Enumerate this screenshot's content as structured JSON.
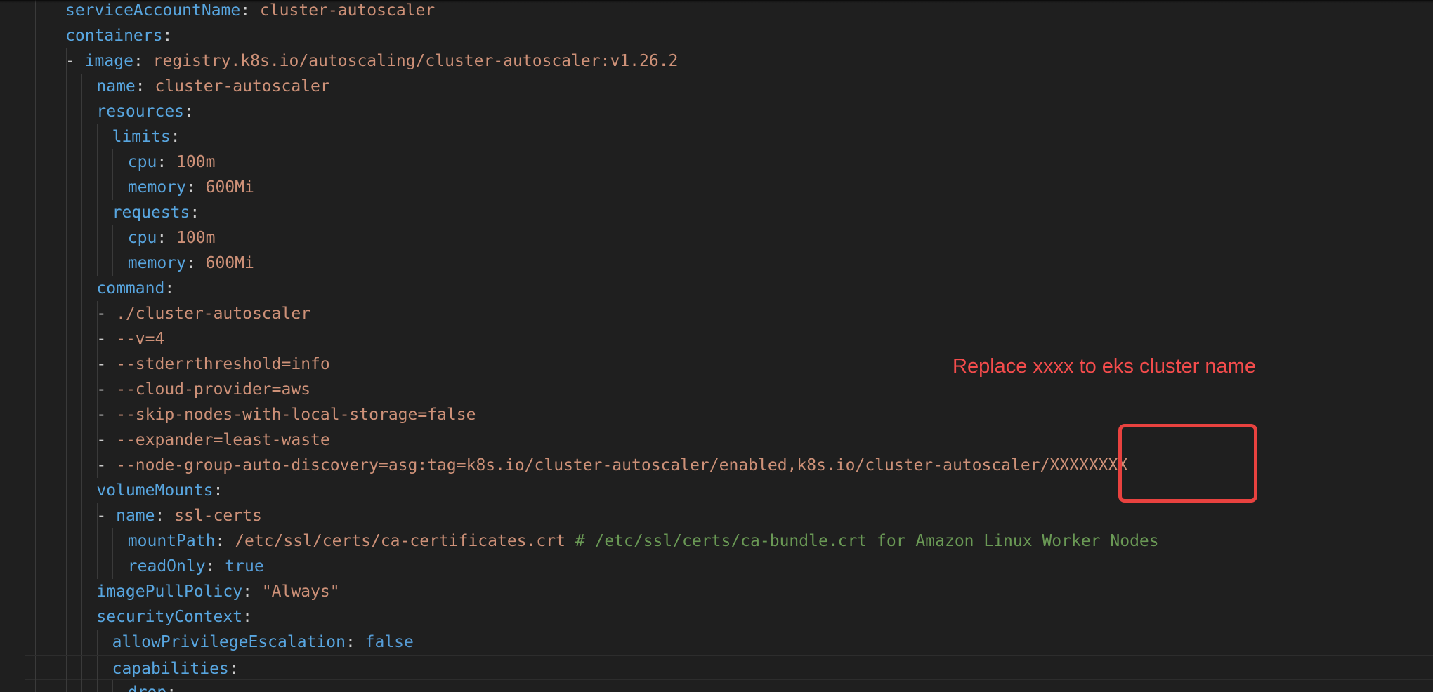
{
  "annotation": {
    "note": "Replace xxxx to eks cluster name"
  },
  "lines": [
    {
      "dash": "",
      "key": "serviceAccountName",
      "sep": ": ",
      "value": "cluster-autoscaler",
      "vtype": "s"
    },
    {
      "dash": "",
      "key": "containers",
      "sep": ":",
      "value": "",
      "vtype": "s"
    },
    {
      "dash": "- ",
      "key": "image",
      "sep": ": ",
      "value": "registry.k8s.io/autoscaling/cluster-autoscaler:v1.26.2",
      "vtype": "s"
    },
    {
      "dash": "",
      "key": "name",
      "sep": ": ",
      "value": "cluster-autoscaler",
      "vtype": "s"
    },
    {
      "dash": "",
      "key": "resources",
      "sep": ":",
      "value": "",
      "vtype": "s"
    },
    {
      "dash": "",
      "key": "limits",
      "sep": ":",
      "value": "",
      "vtype": "s"
    },
    {
      "dash": "",
      "key": "cpu",
      "sep": ": ",
      "value": "100m",
      "vtype": "s"
    },
    {
      "dash": "",
      "key": "memory",
      "sep": ": ",
      "value": "600Mi",
      "vtype": "s"
    },
    {
      "dash": "",
      "key": "requests",
      "sep": ":",
      "value": "",
      "vtype": "s"
    },
    {
      "dash": "",
      "key": "cpu",
      "sep": ": ",
      "value": "100m",
      "vtype": "s"
    },
    {
      "dash": "",
      "key": "memory",
      "sep": ": ",
      "value": "600Mi",
      "vtype": "s"
    },
    {
      "dash": "",
      "key": "command",
      "sep": ":",
      "value": "",
      "vtype": "s"
    },
    {
      "dash": "- ",
      "key": "",
      "sep": "",
      "value": "./cluster-autoscaler",
      "vtype": "s"
    },
    {
      "dash": "- ",
      "key": "",
      "sep": "",
      "value": "--v=4",
      "vtype": "s"
    },
    {
      "dash": "- ",
      "key": "",
      "sep": "",
      "value": "--stderrthreshold=info",
      "vtype": "s"
    },
    {
      "dash": "- ",
      "key": "",
      "sep": "",
      "value": "--cloud-provider=aws",
      "vtype": "s"
    },
    {
      "dash": "- ",
      "key": "",
      "sep": "",
      "value": "--skip-nodes-with-local-storage=false",
      "vtype": "s"
    },
    {
      "dash": "- ",
      "key": "",
      "sep": "",
      "value": "--expander=least-waste",
      "vtype": "s"
    },
    {
      "dash": "- ",
      "key": "",
      "sep": "",
      "value": "--node-group-auto-discovery=asg:tag=k8s.io/cluster-autoscaler/enabled,k8s.io/cluster-autoscaler/XXXXXXXX",
      "vtype": "s"
    },
    {
      "dash": "",
      "key": "volumeMounts",
      "sep": ":",
      "value": "",
      "vtype": "s"
    },
    {
      "dash": "- ",
      "key": "name",
      "sep": ": ",
      "value": "ssl-certs",
      "vtype": "s"
    },
    {
      "dash": "",
      "key": "mountPath",
      "sep": ": ",
      "value": "/etc/ssl/certs/ca-certificates.crt",
      "vtype": "s",
      "comment": " # /etc/ssl/certs/ca-bundle.crt for Amazon Linux Worker Nodes"
    },
    {
      "dash": "",
      "key": "readOnly",
      "sep": ": ",
      "value": "true",
      "vtype": "b"
    },
    {
      "dash": "",
      "key": "imagePullPolicy",
      "sep": ": ",
      "value": "\"Always\"",
      "vtype": "s"
    },
    {
      "dash": "",
      "key": "securityContext",
      "sep": ":",
      "value": "",
      "vtype": "s"
    },
    {
      "dash": "",
      "key": "allowPrivilegeEscalation",
      "sep": ": ",
      "value": "false",
      "vtype": "b"
    },
    {
      "dash": "",
      "key": "capabilities",
      "sep": ":",
      "value": "",
      "vtype": "s"
    },
    {
      "dash": "",
      "key": "drop",
      "sep": ":",
      "value": "",
      "vtype": "s"
    }
  ]
}
